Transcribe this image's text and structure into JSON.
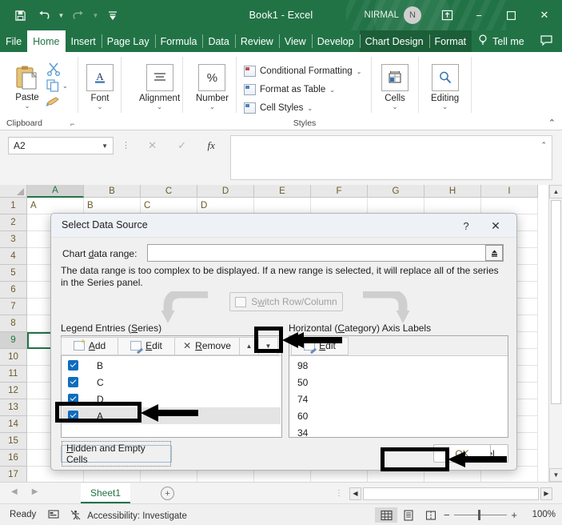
{
  "titlebar": {
    "doc_title": "Book1  -  Excel",
    "user_name": "NIRMAL",
    "avatar_initial": "N",
    "save_icon": "save-icon",
    "undo_icon": "undo-icon",
    "redo_icon": "redo-icon",
    "customize_icon": "customize-quick-access-icon",
    "ribbon_display_icon": "ribbon-display-options-icon",
    "minimize_icon": "minimize-icon",
    "maximize_icon": "maximize-icon",
    "close_icon": "close-icon"
  },
  "tabs": [
    {
      "label": "File",
      "active": false,
      "contextual": false
    },
    {
      "label": "Home",
      "active": true,
      "contextual": false
    },
    {
      "label": "Insert",
      "active": false,
      "contextual": false
    },
    {
      "label": "Page Lay",
      "active": false,
      "contextual": false
    },
    {
      "label": "Formula",
      "active": false,
      "contextual": false
    },
    {
      "label": "Data",
      "active": false,
      "contextual": false
    },
    {
      "label": "Review",
      "active": false,
      "contextual": false
    },
    {
      "label": "View",
      "active": false,
      "contextual": false
    },
    {
      "label": "Develop",
      "active": false,
      "contextual": false
    },
    {
      "label": "Chart Design",
      "active": false,
      "contextual": true
    },
    {
      "label": "Format",
      "active": false,
      "contextual": true
    }
  ],
  "tellme": {
    "label": "Tell me",
    "icon": "lightbulb-icon",
    "comment_icon": "comment-icon"
  },
  "ribbon": {
    "clipboard": {
      "group_label": "Clipboard",
      "paste_label": "Paste",
      "cut_icon": "scissors-icon",
      "copy_icon": "copy-icon",
      "format_painter_icon": "format-painter-icon",
      "launcher_icon": "dialog-launcher-icon"
    },
    "font": {
      "label": "Font",
      "icon": "font-A-icon"
    },
    "alignment": {
      "label": "Alignment",
      "icon": "alignment-icon"
    },
    "number": {
      "label": "Number",
      "icon": "percent-icon"
    },
    "styles": {
      "group_label": "Styles",
      "conditional_formatting": "Conditional Formatting",
      "format_as_table": "Format as Table",
      "cell_styles": "Cell Styles"
    },
    "cells": {
      "label": "Cells",
      "icon": "cells-icon"
    },
    "editing": {
      "label": "Editing",
      "icon": "magnifier-icon"
    },
    "collapse_icon": "collapse-ribbon-icon"
  },
  "formula_bar": {
    "name_box_value": "A2",
    "cancel_icon": "cancel-icon",
    "enter_icon": "enter-icon",
    "fx_icon": "insert-function-icon",
    "formula_value": "",
    "expand_icon": "expand-formula-bar-icon"
  },
  "sheet": {
    "columns": [
      "A",
      "B",
      "C",
      "D",
      "E",
      "F",
      "G",
      "H",
      "I"
    ],
    "selected_column": "A",
    "rows": [
      "1",
      "2",
      "3",
      "4",
      "5",
      "6",
      "7",
      "8",
      "9",
      "10",
      "11",
      "12",
      "13",
      "14",
      "15",
      "16",
      "17"
    ],
    "selected_row": "9",
    "row1_values": [
      "A",
      "B",
      "C",
      "D"
    ],
    "active_cell": "A9"
  },
  "dialog": {
    "title": "Select Data Source",
    "help_icon": "help-question-icon",
    "close_icon": "dialog-close-icon",
    "chart_data_range_label": "Chart data range:",
    "chart_data_range_value": "",
    "range_picker_icon": "collapse-dialog-icon",
    "note": "The data range is too complex to be displayed. If a new range is selected, it will replace all of the series in the Series panel.",
    "switch_button": "Switch Row/Column",
    "switch_icon": "switch-row-column-icon",
    "legend_label": "Legend Entries (Series)",
    "horizontal_label": "Horizontal (Category) Axis Labels",
    "legend_toolbar": {
      "add": "Add",
      "edit": "Edit",
      "remove": "Remove",
      "move_up_icon": "move-up-arrow-icon",
      "move_down_icon": "move-down-arrow-icon",
      "add_icon": "add-series-icon",
      "edit_icon": "edit-series-icon",
      "remove_icon": "remove-series-icon"
    },
    "series": [
      {
        "name": "B",
        "checked": true,
        "selected": false
      },
      {
        "name": "C",
        "checked": true,
        "selected": false
      },
      {
        "name": "D",
        "checked": true,
        "selected": false
      },
      {
        "name": "A",
        "checked": true,
        "selected": true
      }
    ],
    "axis_edit_button": "Edit",
    "axis_edit_icon": "edit-axis-labels-icon",
    "axis_labels": [
      "98",
      "50",
      "74",
      "60",
      "34"
    ],
    "hidden_empty_cells": "Hidden and Empty Cells",
    "ok": "OK",
    "cancel": "Cancel"
  },
  "sheet_tabs": {
    "prev_icon": "previous-sheet-icon",
    "next_icon": "next-sheet-icon",
    "active_sheet": "Sheet1",
    "add_sheet_icon": "add-sheet-icon",
    "split_icon": "split-handle-icon",
    "hscroll_left_icon": "scroll-left-icon",
    "hscroll_right_icon": "scroll-right-icon"
  },
  "status_bar": {
    "status": "Ready",
    "record_macro_icon": "record-macro-icon",
    "accessibility": "Accessibility: Investigate",
    "accessibility_icon": "accessibility-icon",
    "view_normal_icon": "normal-view-icon",
    "view_pagelayout_icon": "page-layout-view-icon",
    "view_pagebreak_icon": "page-break-preview-icon",
    "zoom_out_icon": "zoom-out-icon",
    "zoom_in_icon": "zoom-in-icon",
    "zoom_value": "100%"
  },
  "annotations": {
    "box_series_a": "highlight-box-series-a",
    "arrow_series_a": "callout-arrow-series-a",
    "box_move_down": "highlight-box-move-down",
    "arrow_move_down": "callout-arrow-move-down",
    "arrow_axis_edit": "callout-arrow-axis-edit",
    "box_ok": "highlight-box-ok",
    "arrow_ok": "callout-arrow-ok",
    "grey_arrow_left": "grey-curved-arrow-left",
    "grey_arrow_right": "grey-curved-arrow-right"
  },
  "colors": {
    "excel_green": "#217346",
    "contextual_green": "#1b5e38",
    "checkbox_blue": "#0f6cbd",
    "annotation_black": "#000000"
  }
}
